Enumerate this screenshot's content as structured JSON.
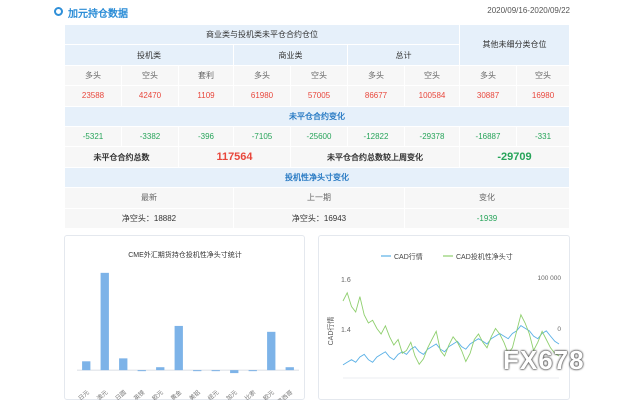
{
  "header": {
    "title": "加元持仓数据",
    "date_range": "2020/09/16-2020/09/22"
  },
  "position_table": {
    "group_title": "商业类与投机类未平仓合约仓位",
    "other_title": "其他未细分类仓位",
    "categories": {
      "speculative": "投机类",
      "commercial": "商业类",
      "total": "总计"
    },
    "col_labels": {
      "long": "多头",
      "short": "空头",
      "spread": "套利"
    },
    "values": {
      "spec_long": "23588",
      "spec_short": "42470",
      "spec_spread": "1109",
      "comm_long": "61980",
      "comm_short": "57005",
      "total_long": "86677",
      "total_short": "100584",
      "other_long": "30887",
      "other_short": "16980"
    },
    "change_title": "未平仓合约变化",
    "changes": {
      "spec_long": "-5321",
      "spec_short": "-3382",
      "spec_spread": "-396",
      "comm_long": "-7105",
      "comm_short": "-25600",
      "total_long": "-12822",
      "total_short": "-29378",
      "other_long": "-16887",
      "other_short": "-331"
    },
    "oi_total_label": "未平仓合约总数",
    "oi_total_value": "117564",
    "oi_change_label": "未平仓合约总数较上周变化",
    "oi_change_value": "-29709",
    "net_title": "投机性净头寸变化",
    "net_headers": {
      "latest": "最新",
      "previous": "上一期",
      "change": "变化"
    },
    "net_values": {
      "latest": "净空头：18882",
      "previous": "净空头：16943",
      "change": "-1939"
    }
  },
  "bar_chart": {
    "chart_data": {
      "type": "bar",
      "title": "CME外汇期货持仓投机性净头寸统计",
      "categories": [
        "日元",
        "澳元",
        "日圆",
        "英镑",
        "欧元",
        "黄金",
        "美铝",
        "纽元",
        "加元",
        "比索",
        "欧元",
        "墨西哥"
      ],
      "tick_labels": [
        "日元",
        "澳元",
        "日圆",
        "英镑",
        "欧元",
        "黄金",
        "美铝",
        "纽元",
        "加元",
        "比索",
        "欧元",
        "墨西哥"
      ],
      "values": [
        3,
        33,
        4,
        0,
        1,
        15,
        0,
        0,
        -1,
        0,
        13,
        1
      ],
      "ylim": [
        -3,
        36
      ],
      "color": "#7db3e8"
    }
  },
  "line_chart": {
    "chart_data": {
      "type": "line",
      "legend": [
        "CAD行情",
        "CAD投机性净头寸"
      ],
      "ylabel": "CAD行情",
      "left_ticks": [
        "1.6",
        "1.4"
      ],
      "right_ticks": [
        "100 000",
        "0"
      ],
      "series": [
        {
          "name": "CAD行情",
          "color": "#5ab0e6",
          "values": [
            1.29,
            1.3,
            1.31,
            1.3,
            1.32,
            1.33,
            1.31,
            1.3,
            1.32,
            1.33,
            1.34,
            1.32,
            1.31,
            1.33,
            1.34,
            1.33,
            1.35,
            1.36,
            1.34,
            1.33,
            1.35,
            1.36,
            1.37,
            1.35,
            1.34,
            1.36,
            1.37,
            1.38,
            1.36,
            1.35,
            1.37,
            1.38,
            1.39,
            1.38,
            1.37,
            1.39,
            1.4,
            1.41,
            1.4,
            1.39,
            1.41,
            1.42,
            1.44,
            1.43,
            1.42,
            1.4,
            1.39,
            1.41,
            1.42,
            1.4,
            1.38,
            1.37
          ]
        },
        {
          "name": "CAD投机性净头寸",
          "color": "#8fcf6e",
          "values": [
            80000,
            95000,
            70000,
            60000,
            88000,
            55000,
            40000,
            45000,
            30000,
            20000,
            35000,
            15000,
            0,
            10000,
            -15000,
            -10000,
            5000,
            -20000,
            -35000,
            -25000,
            -5000,
            10000,
            25000,
            -10000,
            -20000,
            0,
            15000,
            5000,
            -10000,
            -30000,
            -15000,
            10000,
            20000,
            5000,
            -5000,
            15000,
            30000,
            20000,
            5000,
            -15000,
            -5000,
            25000,
            55000,
            40000,
            20000,
            -10000,
            5000,
            25000,
            10000,
            -5000,
            -15000,
            -20000
          ]
        }
      ],
      "left_range": [
        1.24,
        1.66
      ],
      "right_range": [
        -60000,
        140000
      ]
    }
  },
  "watermark": "FX678"
}
